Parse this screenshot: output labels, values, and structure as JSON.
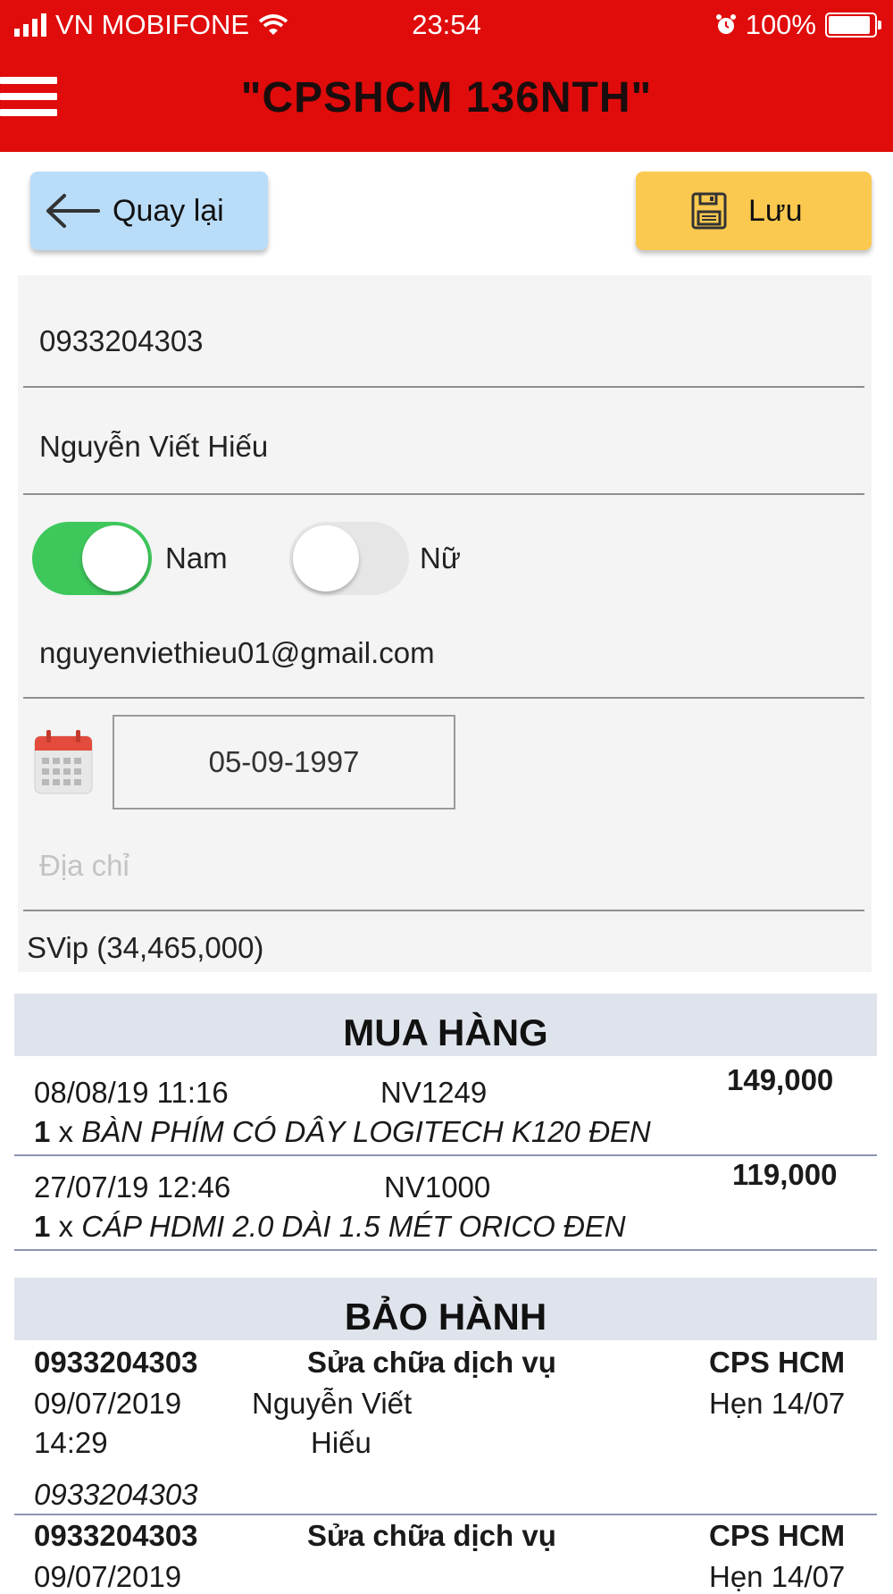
{
  "status_bar": {
    "carrier": "VN MOBIFONE",
    "time": "23:54",
    "battery_text": "100%",
    "battery_level": 1.0,
    "icons": [
      "signal-icon",
      "wifi-icon",
      "alarm-icon",
      "battery-icon"
    ]
  },
  "header": {
    "title": "\"CPSHCM 136NTH\"",
    "menu_icon": "hamburger-menu-icon",
    "background_color": "#e00b0b"
  },
  "actions": {
    "back_label": "Quay lại",
    "save_label": "Lưu",
    "back_icon": "arrow-left-icon",
    "save_icon": "floppy-disk-icon",
    "back_color": "#b9dcf8",
    "save_color": "#fbc94f"
  },
  "form": {
    "phone": "0933204303",
    "name": "Nguyễn Viết Hiếu",
    "gender_male_label": "Nam",
    "gender_female_label": "Nữ",
    "gender_male_on": true,
    "gender_female_on": false,
    "email": "nguyenviethieu01@gmail.com",
    "birthdate": "05-09-1997",
    "calendar_icon": "calendar-icon",
    "address_placeholder": "Địa chỉ",
    "membership": "SVip (34,465,000)"
  },
  "purchases": {
    "title": "MUA HÀNG",
    "items": [
      {
        "datetime": "08/08/19 11:16",
        "staff": "NV1249",
        "amount": "149,000",
        "qty": "1",
        "qty_sep": "x",
        "product": "BÀN PHÍM CÓ DÂY LOGITECH K120 ĐEN"
      },
      {
        "datetime": "27/07/19 12:46",
        "staff": "NV1000",
        "amount": "119,000",
        "qty": "1",
        "qty_sep": "x",
        "product": "CÁP HDMI 2.0 DÀI 1.5 MÉT ORICO ĐEN"
      }
    ]
  },
  "warranty": {
    "title": "BẢO HÀNH",
    "items": [
      {
        "phone": "0933204303",
        "service": "Sửa chữa dịch vụ",
        "store": "CPS HCM",
        "date": "09/07/2019",
        "time": "14:29",
        "customer_line1": "Nguyễn Viết",
        "customer_line2": "Hiếu",
        "appointment": "Hẹn 14/07",
        "contact": "0933204303"
      },
      {
        "phone": "0933204303",
        "service": "Sửa chữa dịch vụ",
        "store": "CPS HCM",
        "date": "09/07/2019",
        "appointment": "Hẹn 14/07"
      }
    ]
  }
}
